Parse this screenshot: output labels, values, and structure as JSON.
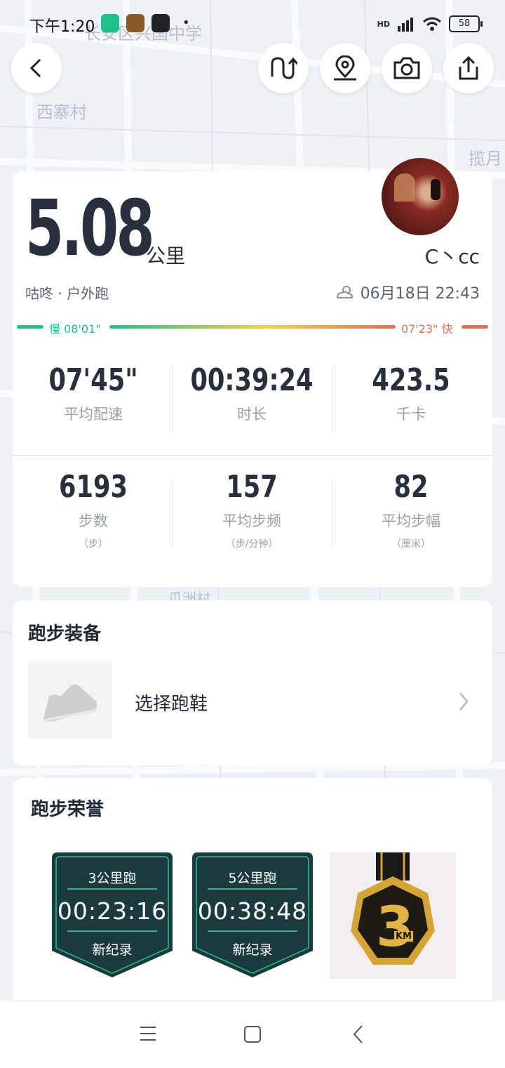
{
  "status_bar": {
    "time": "下午1:20",
    "battery": "58",
    "network": "HD"
  },
  "map": {
    "labels": [
      "长安区兴国中学",
      "西寨村",
      "揽月",
      "瓜洲村"
    ]
  },
  "top_actions": {
    "back_icon": "chevron-left-icon",
    "icons": [
      "route-replay-icon",
      "map-pin-icon",
      "camera-icon",
      "share-icon"
    ]
  },
  "summary": {
    "distance": "5.08",
    "unit": "公里",
    "username": "C丶cc",
    "subtitle": "咕咚 · 户外跑",
    "datetime": "06月18日 22:43",
    "pace_slow": "慢 08'01\"",
    "pace_fast": "07'23\" 快",
    "colors": {
      "slow": "#1ec08c",
      "mid": "#f0d24a",
      "fast": "#e2705a"
    }
  },
  "stats_row1": [
    {
      "value": "07'45\"",
      "label": "平均配速"
    },
    {
      "value": "00:39:24",
      "label": "时长"
    },
    {
      "value": "423.5",
      "label": "千卡"
    }
  ],
  "stats_row2": [
    {
      "value": "6193",
      "label": "步数",
      "sub": "（步）"
    },
    {
      "value": "157",
      "label": "平均步频",
      "sub": "（步/分钟）"
    },
    {
      "value": "82",
      "label": "平均步幅",
      "sub": "（厘米）"
    }
  ],
  "equipment": {
    "title": "跑步装备",
    "choose_shoe": "选择跑鞋"
  },
  "honors": {
    "title": "跑步荣誉",
    "badges": [
      {
        "title": "3公里跑",
        "time": "00:23:16",
        "tag": "新纪录"
      },
      {
        "title": "5公里跑",
        "time": "00:38:48",
        "tag": "新纪录"
      }
    ],
    "medal_text": "3",
    "medal_unit": "KM"
  },
  "navbar": {
    "icons": [
      "menu-icon",
      "home-square-icon",
      "back-triangle-icon"
    ]
  }
}
